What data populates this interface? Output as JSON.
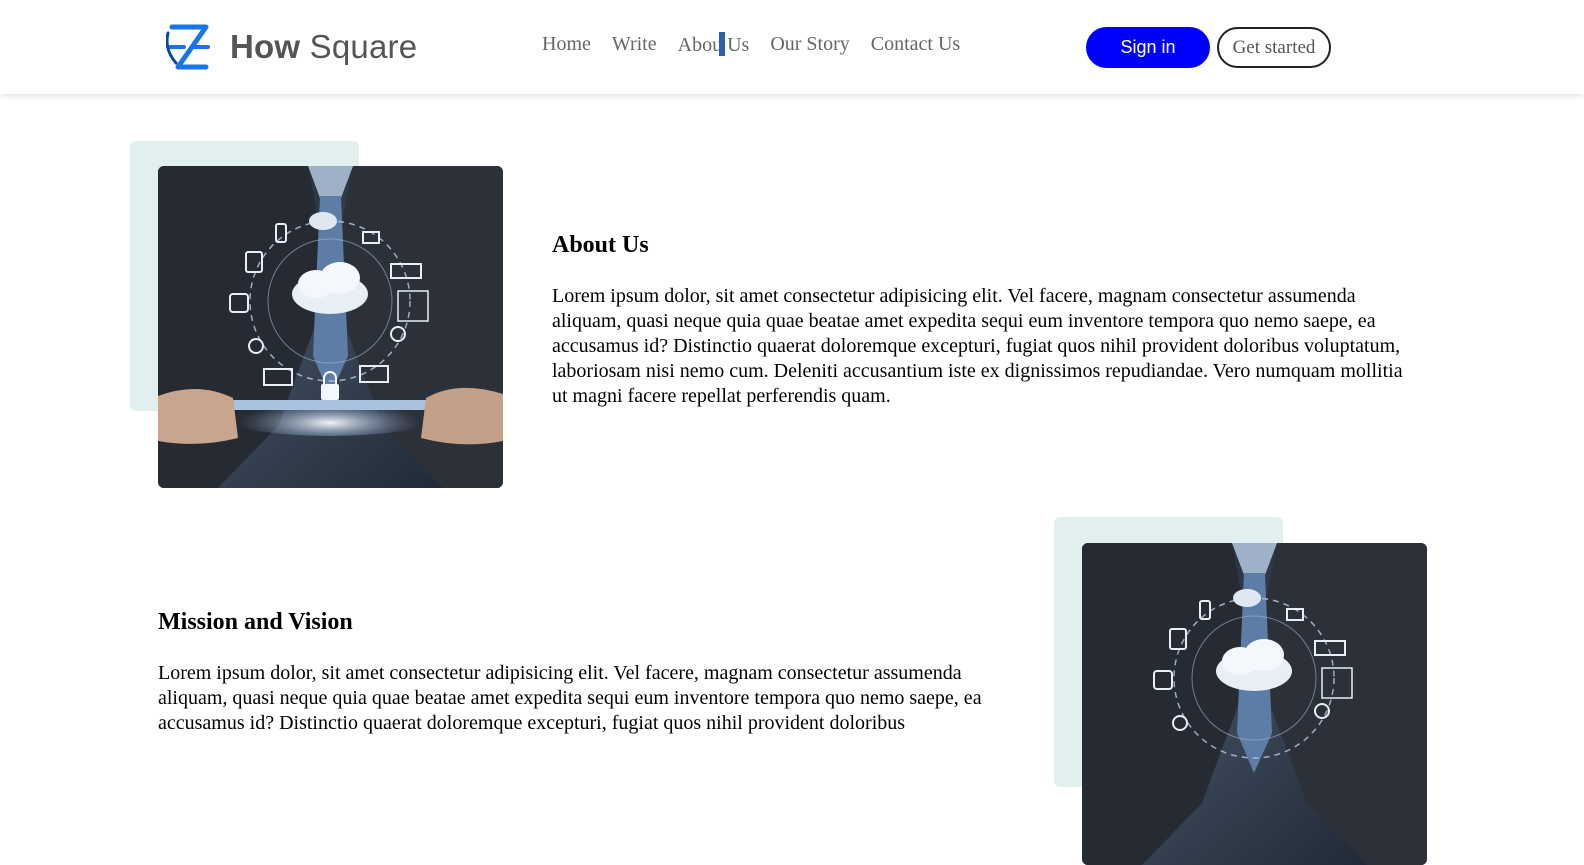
{
  "brand": {
    "name_bold": "How",
    "name_regular": "Square",
    "logo_icon": "z-logo-icon",
    "logo_color": "#1a73e8"
  },
  "nav": {
    "links": [
      "Home",
      "Write",
      "About Us",
      "Our Story",
      "Contact Us"
    ],
    "about_parts": [
      "Abou",
      "t",
      " Us"
    ],
    "signin_label": "Sign in",
    "get_started_label": "Get started",
    "signin_color": "#0000ff"
  },
  "about": {
    "title": "About Us",
    "body": "Lorem ipsum dolor, sit amet consectetur adipisicing elit. Vel facere, magnam consectetur assumenda aliquam, quasi neque quia quae beatae amet expedita sequi eum inventore tempora quo nemo saepe, ea accusamus id? Distinctio quaerat doloremque excepturi, fugiat quos nihil provident doloribus voluptatum, laboriosam nisi nemo cum. Deleniti accusantium iste ex dignissimos repudiandae. Vero numquam mollitia ut magni facere repellat perferendis quam.",
    "image_icon": "cloud-technology-image"
  },
  "mission": {
    "title": "Mission and Vision",
    "body": "Lorem ipsum dolor, sit amet consectetur adipisicing elit. Vel facere, magnam consectetur assumenda aliquam, quasi neque quia quae beatae amet expedita sequi eum inventore tempora quo nemo saepe, ea accusamus id? Distinctio quaerat doloremque excepturi, fugiat quos nihil provident doloribus",
    "image_icon": "cloud-technology-image"
  },
  "colors": {
    "decor_bg": "#e1f0ee",
    "nav_text": "#666666"
  }
}
